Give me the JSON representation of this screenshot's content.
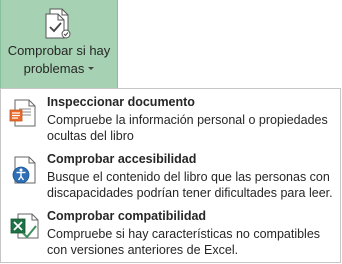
{
  "ribbon": {
    "button_label_line1": "Comprobar si hay",
    "button_label_line2": "problemas",
    "icon": "document-check-icon",
    "active_color": "#a6d2b3"
  },
  "menu": {
    "items": [
      {
        "title": "Inspeccionar documento",
        "description": "Compruebe la información personal o propiedades ocultas del libro",
        "icon": "inspect-document-icon"
      },
      {
        "title": "Comprobar accesibilidad",
        "description": "Busque el contenido del libro que las personas con discapacidades podrían tener dificultades para leer.",
        "icon": "accessibility-icon"
      },
      {
        "title": "Comprobar compatibilidad",
        "description": "Compruebe si hay características no compatibles con versiones anteriores de Excel.",
        "icon": "compatibility-icon"
      }
    ]
  }
}
